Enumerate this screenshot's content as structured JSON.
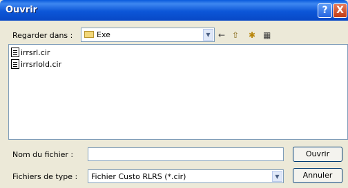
{
  "window": {
    "title": "Ouvrir"
  },
  "titlebar": {
    "help": "?",
    "close": "X"
  },
  "lookin": {
    "label": "Regarder dans :",
    "value": "Exe"
  },
  "toolbar": {
    "back": "←",
    "up": "⇧",
    "new_folder": "✱",
    "views": "▦"
  },
  "files": [
    {
      "name": "irrsrl.cir"
    },
    {
      "name": "irrsrlold.cir"
    }
  ],
  "filename": {
    "label": "Nom du fichier :",
    "value": ""
  },
  "filetype": {
    "label": "Fichiers de type :",
    "value": "Fichier Custo RLRS (*.cir)"
  },
  "buttons": {
    "open": "Ouvrir",
    "cancel": "Annuler"
  }
}
